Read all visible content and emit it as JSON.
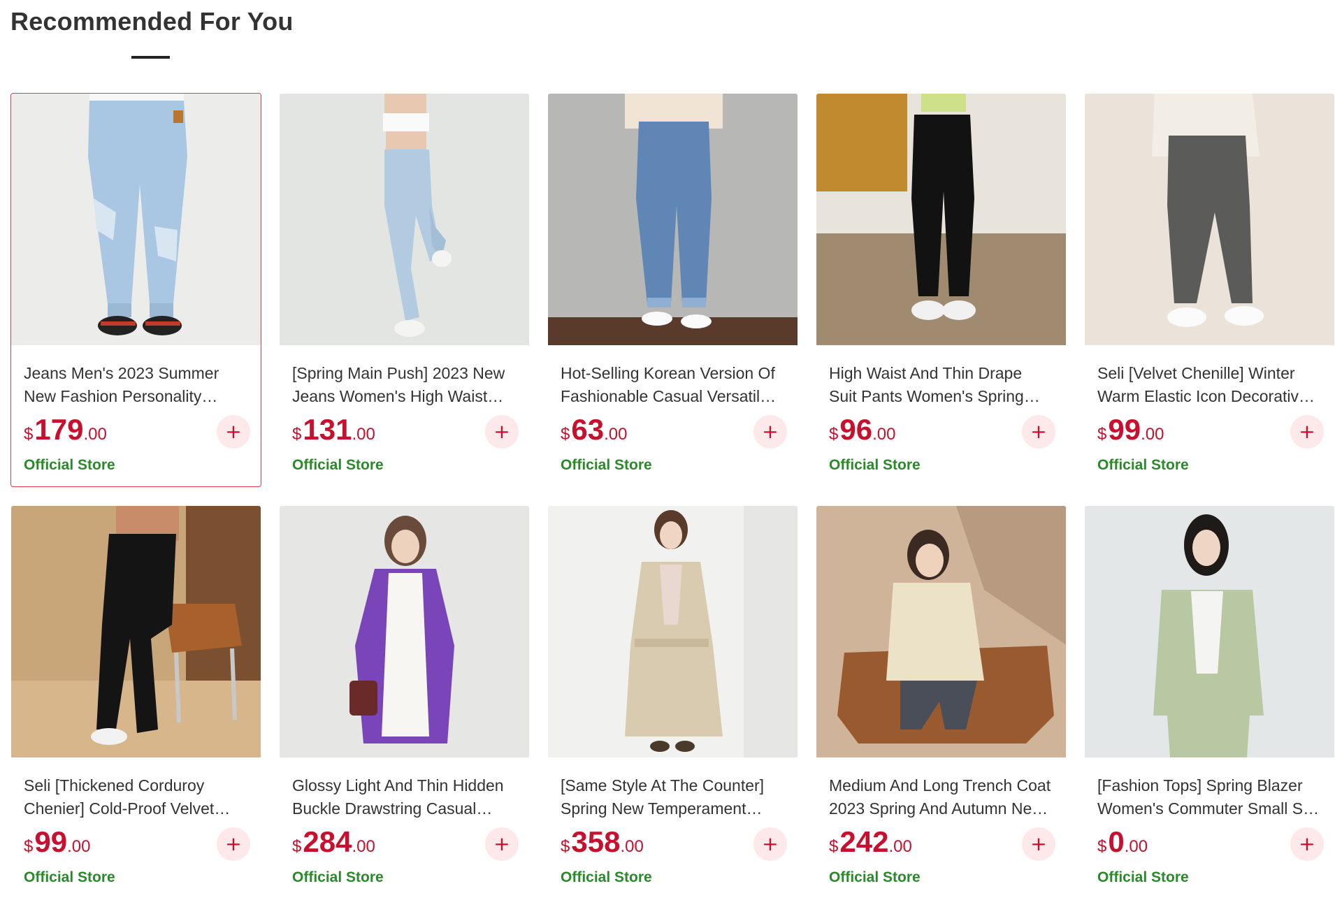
{
  "section": {
    "title": "Recommended For You"
  },
  "colors": {
    "price": "#c8102e",
    "store": "#2a8a2a",
    "active_border": "#e8394c",
    "add_button_bg": "#fde8ea"
  },
  "products": [
    {
      "name": "Jeans Men's 2023 Summer New Fashion Personality Ripped Loose Straight Denim Trousers",
      "currency": "$",
      "price_int": "179",
      "price_dec": ".00",
      "store": "Official Store",
      "add_icon": "+",
      "image": "light-blue-ripped-jeans"
    },
    {
      "name": "[Spring Main Push] 2023 New Jeans Women's High Waist Slim Cropped Pants",
      "currency": "$",
      "price_int": "131",
      "price_dec": ".00",
      "store": "Official Store",
      "add_icon": "+",
      "image": "light-blue-slim-jeans"
    },
    {
      "name": "Hot-Selling Korean Version Of Fashionable Casual Versatile Straight Jeans",
      "currency": "$",
      "price_int": "63",
      "price_dec": ".00",
      "store": "Official Store",
      "add_icon": "+",
      "image": "mid-blue-straight-jeans"
    },
    {
      "name": "High Waist And Thin Drape Suit Pants Women's Spring Straight Trousers",
      "currency": "$",
      "price_int": "96",
      "price_dec": ".00",
      "store": "Official Store",
      "add_icon": "+",
      "image": "black-suit-pants"
    },
    {
      "name": "Seli [Velvet Chenille] Winter Warm Elastic Icon Decorative Harem Pants",
      "currency": "$",
      "price_int": "99",
      "price_dec": ".00",
      "store": "Official Store",
      "add_icon": "+",
      "image": "grey-chenille-pants"
    },
    {
      "name": "Seli [Thickened Corduroy Chenier] Cold-Proof Velvet Straight Pants",
      "currency": "$",
      "price_int": "99",
      "price_dec": ".00",
      "store": "Official Store",
      "add_icon": "+",
      "image": "black-corduroy-pants"
    },
    {
      "name": "Glossy Light And Thin Hidden Buckle Drawstring Casual Windbreaker",
      "currency": "$",
      "price_int": "284",
      "price_dec": ".00",
      "store": "Official Store",
      "add_icon": "+",
      "image": "purple-windbreaker"
    },
    {
      "name": "[Same Style At The Counter] Spring New Temperament Belted Trench Coat",
      "currency": "$",
      "price_int": "358",
      "price_dec": ".00",
      "store": "Official Store",
      "add_icon": "+",
      "image": "beige-trench-coat"
    },
    {
      "name": "Medium And Long Trench Coat 2023 Spring And Autumn New Women's Jacket",
      "currency": "$",
      "price_int": "242",
      "price_dec": ".00",
      "store": "Official Store",
      "add_icon": "+",
      "image": "cream-short-trench"
    },
    {
      "name": "[Fashion Tops] Spring Blazer Women's Commuter Small Suit Jacket",
      "currency": "$",
      "price_int": "0",
      "price_dec": ".00",
      "store": "Official Store",
      "add_icon": "+",
      "image": "sage-green-blazer"
    }
  ]
}
